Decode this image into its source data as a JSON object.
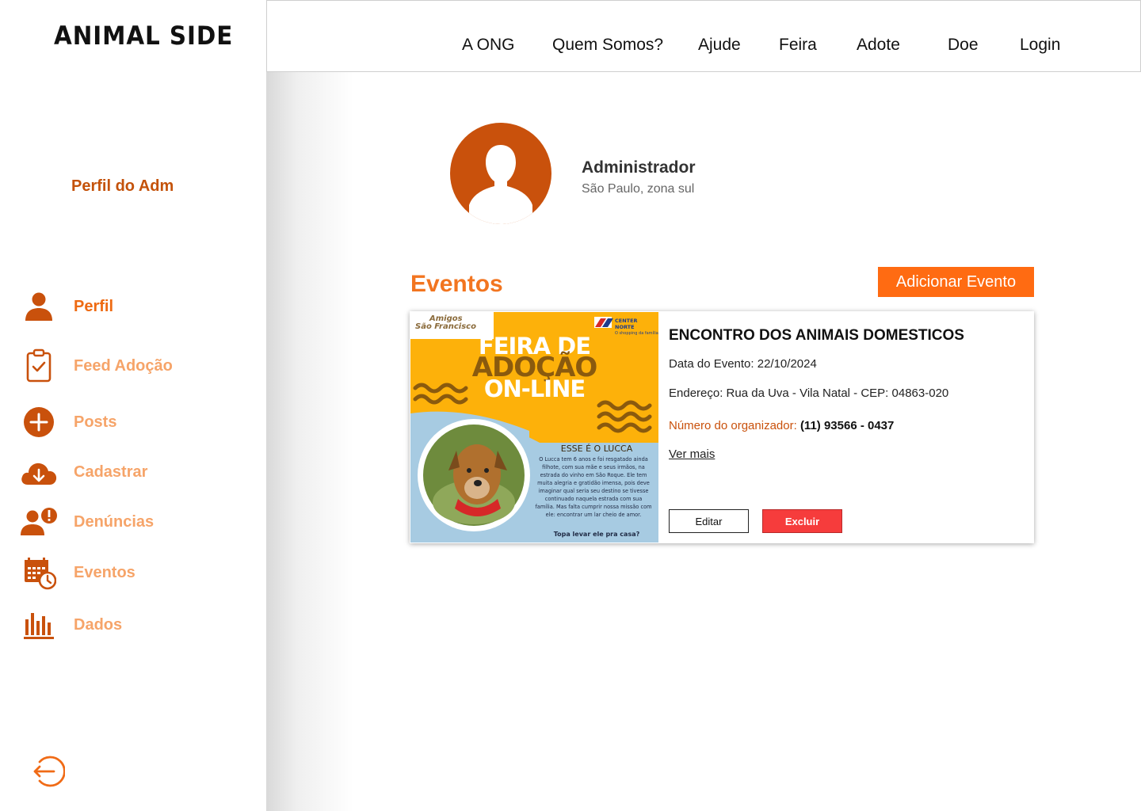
{
  "brand": {
    "logo_text": "ANIMAL SIDE"
  },
  "colors": {
    "accent": "#FF6B12",
    "accent_dark": "#C9510C",
    "nav_inactive": "#F6A469",
    "danger": "#F63C3C"
  },
  "topnav": {
    "links": [
      {
        "label": "A ONG"
      },
      {
        "label": "Quem Somos?"
      },
      {
        "label": "Ajude"
      },
      {
        "label": "Feira"
      },
      {
        "label": "Adote"
      },
      {
        "label": "Doe"
      },
      {
        "label": "Login"
      }
    ]
  },
  "sidebar": {
    "title": "Perfil do Adm",
    "items": [
      {
        "label": "Perfil",
        "icon": "user-icon"
      },
      {
        "label": "Feed Adoção",
        "icon": "clipboard-check-icon"
      },
      {
        "label": "Posts",
        "icon": "plus-circle-icon"
      },
      {
        "label": "Cadastrar",
        "icon": "cloud-download-icon"
      },
      {
        "label": "Denúncias",
        "icon": "user-alert-icon"
      },
      {
        "label": "Eventos",
        "icon": "calendar-clock-icon"
      },
      {
        "label": "Dados",
        "icon": "bar-chart-icon"
      }
    ],
    "active": "Eventos",
    "logout_icon": "logout-icon"
  },
  "profile": {
    "name": "Administrador",
    "location": "São Paulo, zona sul",
    "avatar_icon": "user-silhouette-icon"
  },
  "events": {
    "heading": "Eventos",
    "add_button": "Adicionar Evento",
    "items": [
      {
        "title": "ENCONTRO DOS ANIMAIS DOMESTICOS",
        "date": "Data do Evento: 22/10/2024",
        "address": "Endereço:  Rua da Uva - Vila Natal - CEP: 04863-020",
        "organizer_label": "Número do organizador:",
        "organizer_phone": "(11) 93566 - 0437",
        "more_link": "Ver mais",
        "edit_button": "Editar",
        "delete_button": "Excluir",
        "poster": {
          "brand_left_line1": "Amigos",
          "brand_left_line2": "São Francisco",
          "brand_right_code": "CN",
          "brand_right_name": "CENTER NORTE",
          "brand_right_sub": "O shopping da família",
          "headline1": "FEIRA DE",
          "headline2": "ADOÇÃO",
          "headline3": "ON-LINE",
          "subhead": "ESSE É O LUCCA",
          "body": "O Lucca tem 6 anos e foi resgatado ainda filhote, com sua mãe e seus irmãos, na estrada do vinho em São Roque. Ele tem muita alegria e gratidão imensa, pois deve imaginar qual seria seu destino se tivesse continuado naquela estrada com sua família. Mas falta cumprir nossa missão com ele: encontrar um lar cheio de amor.",
          "cta": "Topa levar ele pra casa?"
        }
      }
    ]
  }
}
